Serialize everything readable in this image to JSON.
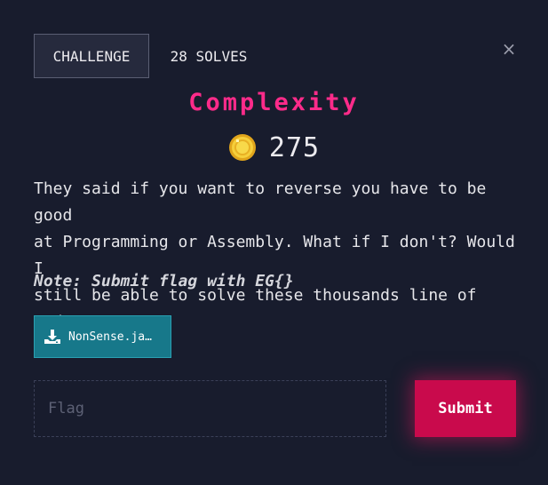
{
  "tabs": {
    "challenge_label": "CHALLENGE",
    "solves_label": "28 SOLVES"
  },
  "close_label": "×",
  "challenge": {
    "title": "Complexity",
    "points": "275",
    "description": "They said if you want to reverse you have to be good\nat Programming or Assembly. What if I don't? Would I\nstill be able to solve these thousands line of codes?",
    "note": "Note: Submit flag with EG{}"
  },
  "file": {
    "label": "NonSense.ja…",
    "icon": "download-icon"
  },
  "form": {
    "flag_placeholder": "Flag",
    "flag_value": "",
    "submit_label": "Submit"
  },
  "colors": {
    "background": "#181c2d",
    "title": "#ff2b8a",
    "file_button": "#17788a",
    "submit": "#c90a4c",
    "coin": "#f2c12e"
  }
}
